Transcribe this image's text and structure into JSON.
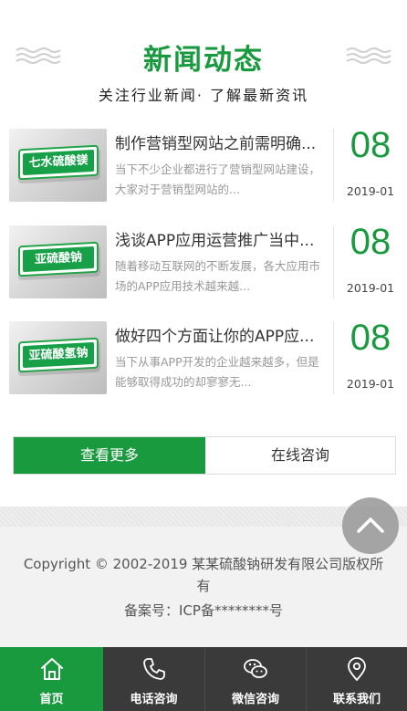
{
  "section": {
    "title": "新闻动态",
    "subtitle": "关注行业新闻· 了解最新资讯"
  },
  "news": [
    {
      "thumb_label": "七水硫酸镁",
      "title": "制作营销型网站之前需明确...",
      "desc": "当下不少企业都进行了营销型网站建设，大家对于营销型网站的...",
      "day": "08",
      "year_month": "2019-01"
    },
    {
      "thumb_label": "亚硫酸钠",
      "title": "浅谈APP应用运营推广当中...",
      "desc": "随着移动互联网的不断发展，各大应用市场的APP应用技术越来越...",
      "day": "08",
      "year_month": "2019-01"
    },
    {
      "thumb_label": "亚硫酸氢钠",
      "title": "做好四个方面让你的APP应...",
      "desc": "当下从事APP开发的企业越来越多，但是能够取得成功的却寥寥无...",
      "day": "08",
      "year_month": "2019-01"
    }
  ],
  "actions": {
    "more": "查看更多",
    "consult": "在线咨询"
  },
  "footer": {
    "copyright": "Copyright © 2002-2019 某某硫酸钠研发有限公司版权所有",
    "icp": "备案号：ICP备********号"
  },
  "bottom_nav": [
    {
      "label": "首页",
      "icon": "home-icon",
      "active": true
    },
    {
      "label": "电话咨询",
      "icon": "phone-icon",
      "active": false
    },
    {
      "label": "微信咨询",
      "icon": "wechat-icon",
      "active": false
    },
    {
      "label": "联系我们",
      "icon": "location-icon",
      "active": false
    }
  ],
  "colors": {
    "brand_green": "#1a9a3f",
    "nav_dark": "#3a3a3a",
    "footer_bg": "#f2f2f2"
  }
}
